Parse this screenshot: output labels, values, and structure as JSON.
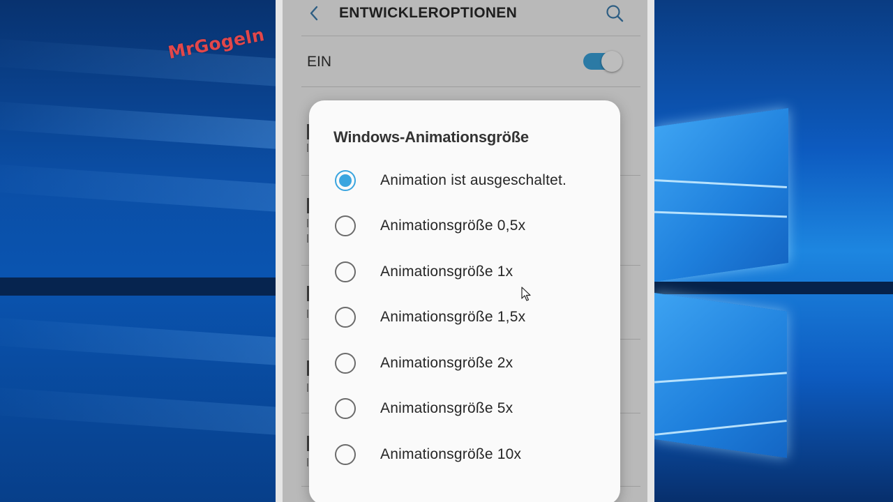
{
  "watermark": "MrGogeln",
  "appbar": {
    "title": "ENTWICKLEROPTIONEN",
    "back_icon": "chevron-left-icon",
    "search_icon": "search-icon"
  },
  "master_switch": {
    "label": "EIN",
    "state": "on",
    "accent_color": "#3aa5df"
  },
  "dialog": {
    "title": "Windows-Animationsgröße",
    "selected_index": 0,
    "options": [
      {
        "label": "Animation ist ausgeschaltet.",
        "checked": true
      },
      {
        "label": "Animationsgröße 0,5x",
        "checked": false
      },
      {
        "label": "Animationsgröße 1x",
        "checked": false
      },
      {
        "label": "Animationsgröße 1,5x",
        "checked": false
      },
      {
        "label": "Animationsgröße 2x",
        "checked": false
      },
      {
        "label": "Animationsgröße 5x",
        "checked": false
      },
      {
        "label": "Animationsgröße 10x",
        "checked": false
      }
    ]
  }
}
